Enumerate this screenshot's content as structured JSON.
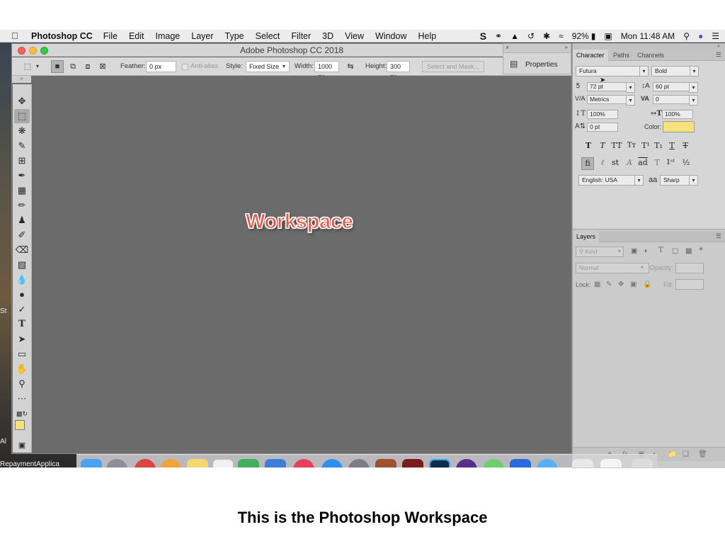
{
  "menubar": {
    "app": "Photoshop CC",
    "items": [
      "File",
      "Edit",
      "Image",
      "Layer",
      "Type",
      "Select",
      "Filter",
      "3D",
      "View",
      "Window",
      "Help"
    ],
    "battery": "92%",
    "clock": "Mon 11:48 AM"
  },
  "desktop": {
    "text1": "St",
    "text2": "Al",
    "text3": "RepaymentApplica"
  },
  "window": {
    "title": "Adobe Photoshop CC 2018"
  },
  "options": {
    "feather_label": "Feather:",
    "feather_value": "0 px",
    "antialias_label": "Anti-alias",
    "style_label": "Style:",
    "style_value": "Fixed Size",
    "width_label": "Width:",
    "width_value": "1000 px",
    "height_label": "Height:",
    "height_value": "300 px",
    "select_mask": "Select and Mask..."
  },
  "canvas": {
    "text": "Workspace",
    "text_color": "#e4584a"
  },
  "properties": {
    "label": "Properties"
  },
  "character": {
    "tabs": [
      "Character",
      "Paths",
      "Channels"
    ],
    "font_family": "Futura",
    "font_style": "Bold",
    "font_size": "72 pt",
    "leading": "60 pt",
    "kerning": "Metrics",
    "tracking": "0",
    "vertical_scale": "100%",
    "horizontal_scale": "100%",
    "baseline_shift": "0 pt",
    "color_label": "Color:",
    "color_value": "#f5e27a",
    "language": "English: USA",
    "aa_label": "aa",
    "antialias": "Sharp"
  },
  "layers": {
    "tab": "Layers",
    "filter": "Kind",
    "blend_mode": "Normal",
    "opacity_label": "Opacity:",
    "lock_label": "Lock:",
    "fill_label": "Fill:"
  },
  "caption": "This is the Photoshop Workspace"
}
